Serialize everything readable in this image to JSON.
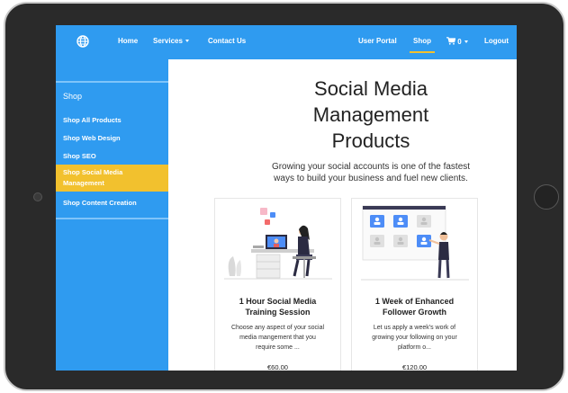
{
  "navbar": {
    "items_left": [
      "Home",
      "Services",
      "Contact Us"
    ],
    "user_portal": "User Portal",
    "shop": "Shop",
    "cart_count": "0",
    "logout": "Logout",
    "brand_color": "#2f9bf0",
    "accent_color": "#f2c12e"
  },
  "sidebar": {
    "heading": "Shop",
    "items": [
      {
        "label": "Shop All Products"
      },
      {
        "label": "Shop Web Design"
      },
      {
        "label": "Shop SEO"
      },
      {
        "label": "Shop Social Media Management",
        "active": true
      },
      {
        "label": "Shop Content Creation"
      }
    ]
  },
  "main": {
    "title_lines": [
      "Social Media",
      "Management",
      "Products"
    ],
    "subtitle_lines": [
      "Growing your social accounts is one of the fastest",
      "ways to build your business and fuel new clients."
    ]
  },
  "products": [
    {
      "title_lines": [
        "1 Hour Social Media",
        "Training Session"
      ],
      "desc_lines": [
        "Choose any aspect of your social",
        "media mangement that you",
        "require some ..."
      ],
      "price": "€60.00",
      "illustration": "person-at-desk-video-call"
    },
    {
      "title_lines": [
        "1 Week of Enhanced",
        "Follower Growth"
      ],
      "desc_lines": [
        "Let us apply a week's work of",
        "growing your following on your",
        "platform o..."
      ],
      "price": "€120.00",
      "illustration": "person-with-profile-grid"
    }
  ]
}
